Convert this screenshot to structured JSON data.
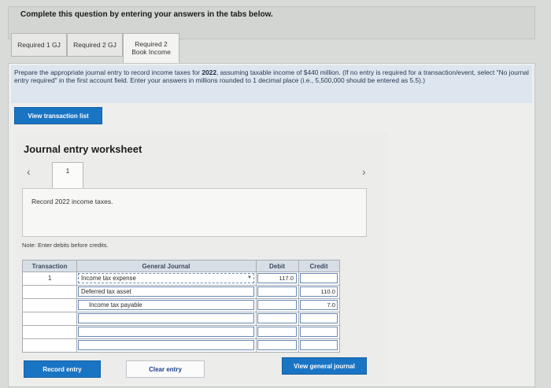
{
  "instruction": "Complete this question by entering your answers in the tabs below.",
  "tabs": [
    {
      "label": "Required 1 GJ"
    },
    {
      "label": "Required 2 GJ"
    },
    {
      "label_line1": "Required 2",
      "label_line2": "Book Income"
    }
  ],
  "prompt": {
    "part1": "Prepare the appropriate journal entry to record income taxes for ",
    "year": "2022",
    "part2": ", assuming taxable income of $440 million. (If no entry is required for a transaction/event, select \"No journal entry required\" in the first account field. Enter your answers in millions rounded to 1 decimal place (i.e., 5,500,000 should be entered as 5.5).)"
  },
  "buttons": {
    "view_transaction_list": "View transaction list",
    "record_entry": "Record entry",
    "clear_entry": "Clear entry",
    "view_general_journal": "View general journal"
  },
  "worksheet": {
    "title": "Journal entry worksheet",
    "page_number": "1",
    "description": "Record 2022 income taxes.",
    "note": "Note: Enter debits before credits."
  },
  "table": {
    "headers": {
      "transaction": "Transaction",
      "general_journal": "General Journal",
      "debit": "Debit",
      "credit": "Credit"
    },
    "rows": [
      {
        "transaction": "1",
        "account": "Income tax expense",
        "debit": "117.0",
        "credit": ""
      },
      {
        "transaction": "",
        "account": "Deferred tax asset",
        "debit": "",
        "credit": "110.0"
      },
      {
        "transaction": "",
        "account": "Income tax payable",
        "debit": "",
        "credit": "7.0"
      },
      {
        "transaction": "",
        "account": "",
        "debit": "",
        "credit": ""
      },
      {
        "transaction": "",
        "account": "",
        "debit": "",
        "credit": ""
      },
      {
        "transaction": "",
        "account": "",
        "debit": "",
        "credit": ""
      }
    ]
  },
  "icons": {
    "prev": "chevron-left-icon",
    "next": "chevron-right-icon",
    "dropdown": "dropdown-arrow-icon"
  }
}
